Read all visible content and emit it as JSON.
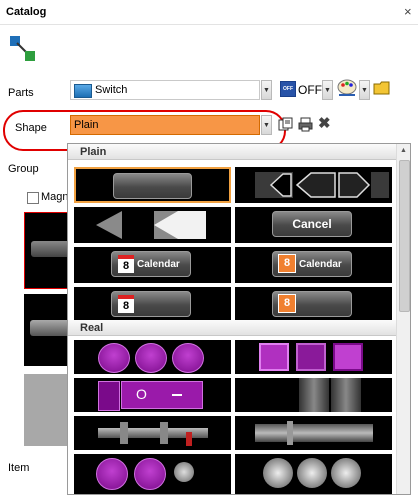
{
  "window": {
    "title": "Catalog",
    "close_glyph": "×"
  },
  "labels": {
    "parts": "Parts",
    "shape": "Shape",
    "group": "Group",
    "item": "Item",
    "magnify": "Magn"
  },
  "parts": {
    "value": "Switch",
    "off_label": "OFF",
    "off_badge": "OFF"
  },
  "shape": {
    "value": "Plain"
  },
  "popup": {
    "sections": [
      {
        "title": "Plain"
      },
      {
        "title": "Real"
      }
    ],
    "cancel_label": "Cancel",
    "calendar_label": "Calendar",
    "calendar_day": "8",
    "off_text": "O"
  },
  "colors": {
    "accent": "#f79646",
    "highlight": "#e00000",
    "purple": "#a020b0"
  }
}
